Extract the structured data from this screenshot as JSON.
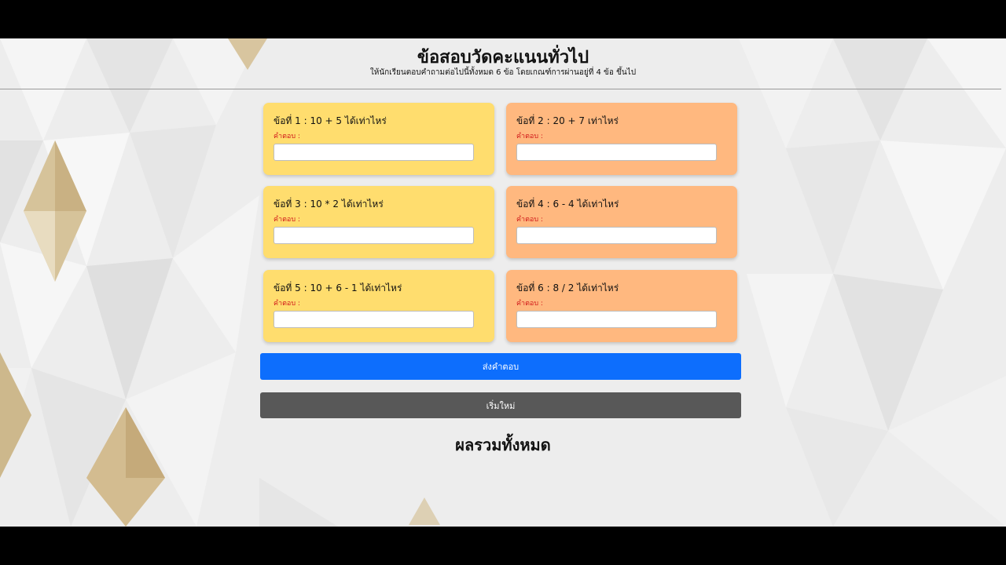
{
  "header": {
    "title": "ข้อสอบวัดคะแนนทั่วไป",
    "subtitle": "ให้นักเรียนตอบคำถามต่อไปนี้ทั้งหมด 6 ข้อ โดยเกณฑ์การผ่านอยู่ที่ 4 ข้อ ขึ้นไป"
  },
  "questions": [
    {
      "text": "ข้อที่ 1 : 10 + 5 ได้เท่าไหร่",
      "answer_label": "คำตอบ :",
      "value": ""
    },
    {
      "text": "ข้อที่ 2 : 20 + 7 เท่าไหร่",
      "answer_label": "คำตอบ :",
      "value": ""
    },
    {
      "text": "ข้อที่ 3 : 10 * 2 ได้เท่าไหร่",
      "answer_label": "คำตอบ :",
      "value": ""
    },
    {
      "text": "ข้อที่ 4 : 6 - 4 ได้เท่าไหร่",
      "answer_label": "คำตอบ :",
      "value": ""
    },
    {
      "text": "ข้อที่ 5 : 10 + 6 - 1 ได้เท่าไหร่",
      "answer_label": "คำตอบ :",
      "value": ""
    },
    {
      "text": "ข้อที่ 6 : 8 / 2 ได้เท่าไหร่",
      "answer_label": "คำตอบ :",
      "value": ""
    }
  ],
  "buttons": {
    "submit_label": "ส่งคำตอบ",
    "reset_label": "เริ่มใหม่"
  },
  "result": {
    "title": "ผลรวมทั้งหมด"
  },
  "colors": {
    "yellow_card": "#ffdd6e",
    "orange_card": "#ffb87f",
    "answer_label": "#d11a1a",
    "submit_button": "#0d6efd",
    "reset_button": "#585858"
  }
}
